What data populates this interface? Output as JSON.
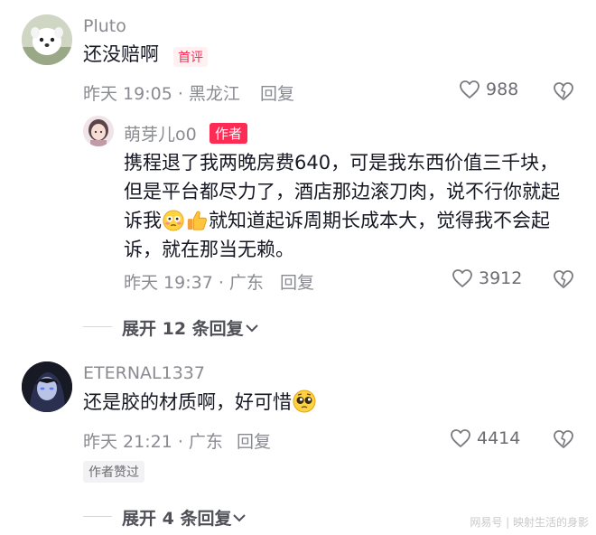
{
  "comments": [
    {
      "username": "Pluto",
      "text": "还没赔啊",
      "badge": "首评",
      "meta": "昨天 19:05 · 黑龙江",
      "reply_label": "回复",
      "likes": "988",
      "replies": [
        {
          "username": "萌芽儿o0",
          "badge": "作者",
          "text_parts": [
            "携程退了我两晚房费640，可是我东西价值三千块，但是平台都尽力了，酒店那边滚刀肉，说不行你就起诉我",
            "就知道起诉周期长成本大，觉得我不会起诉，就在那当无赖。"
          ],
          "meta": "昨天 19:37 · 广东",
          "reply_label": "回复",
          "likes": "3912"
        }
      ],
      "expand_label": "展开 12 条回复"
    },
    {
      "username": "ETERNAL1337",
      "text": "还是胶的材质啊，好可惜",
      "meta": "昨天 21:21 · 广东",
      "reply_label": "回复",
      "likes": "4414",
      "author_liked_badge": "作者赞过",
      "expand_label": "展开 4 条回复"
    }
  ],
  "watermark": "网易号 | 映射生活的身影",
  "colors": {
    "accent": "#fe2c55",
    "muted": "#8a8b91"
  }
}
